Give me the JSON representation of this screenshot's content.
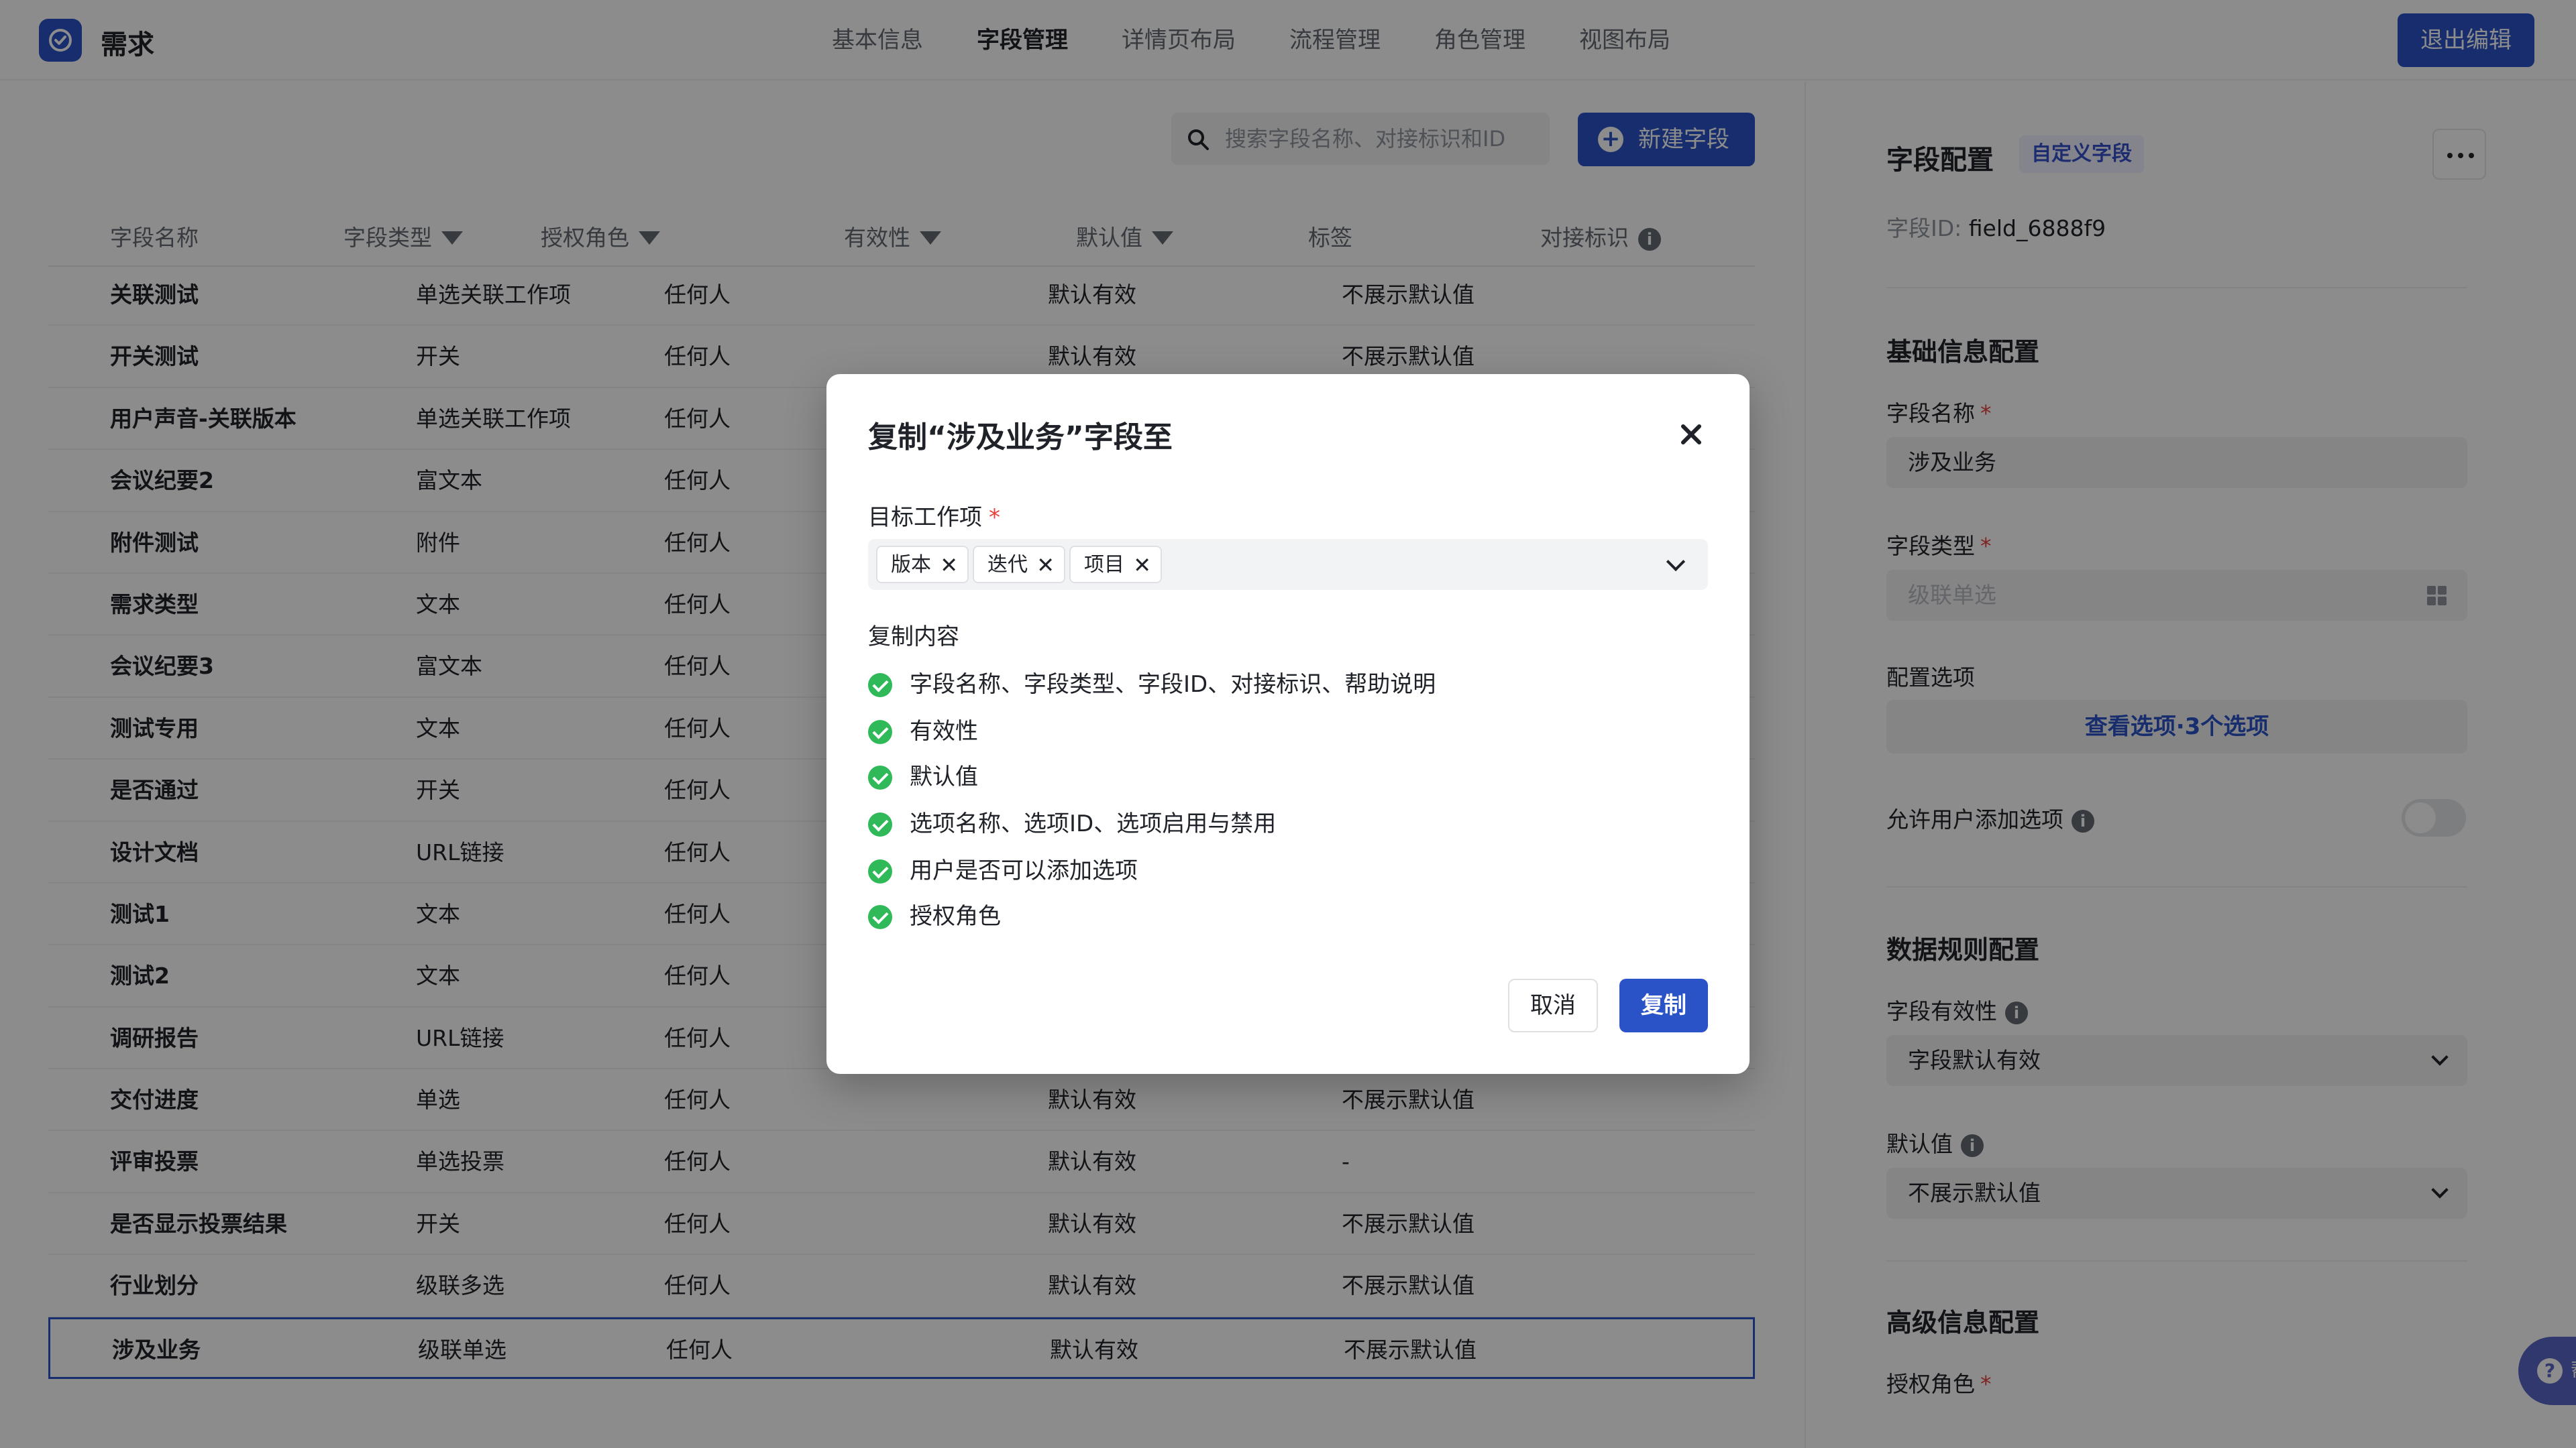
{
  "app": {
    "title": "需求"
  },
  "nav": {
    "tabs": [
      {
        "label": "基本信息",
        "active": false
      },
      {
        "label": "字段管理",
        "active": true
      },
      {
        "label": "详情页布局",
        "active": false
      },
      {
        "label": "流程管理",
        "active": false
      },
      {
        "label": "角色管理",
        "active": false
      },
      {
        "label": "视图布局",
        "active": false
      }
    ],
    "exit_label": "退出编辑"
  },
  "toolbar": {
    "search_placeholder": "搜索字段名称、对接标识和ID",
    "new_field_label": "新建字段"
  },
  "table": {
    "headers": [
      "字段名称",
      "字段类型",
      "授权角色",
      "有效性",
      "默认值",
      "标签",
      "对接标识"
    ],
    "rows": [
      {
        "name": "关联测试",
        "type": "单选关联工作项",
        "role": "任何人",
        "valid": "默认有效",
        "default": "不展示默认值"
      },
      {
        "name": "开关测试",
        "type": "开关",
        "role": "任何人",
        "valid": "默认有效",
        "default": "不展示默认值"
      },
      {
        "name": "用户声音-关联版本",
        "type": "单选关联工作项",
        "role": "任何人",
        "valid": "",
        "default": ""
      },
      {
        "name": "会议纪要2",
        "type": "富文本",
        "role": "任何人",
        "valid": "",
        "default": ""
      },
      {
        "name": "附件测试",
        "type": "附件",
        "role": "任何人",
        "valid": "",
        "default": ""
      },
      {
        "name": "需求类型",
        "type": "文本",
        "role": "任何人",
        "valid": "",
        "default": ""
      },
      {
        "name": "会议纪要3",
        "type": "富文本",
        "role": "任何人",
        "valid": "",
        "default": ""
      },
      {
        "name": "测试专用",
        "type": "文本",
        "role": "任何人",
        "valid": "",
        "default": ""
      },
      {
        "name": "是否通过",
        "type": "开关",
        "role": "任何人",
        "valid": "",
        "default": ""
      },
      {
        "name": "设计文档",
        "type": "URL链接",
        "role": "任何人",
        "valid": "",
        "default": ""
      },
      {
        "name": "测试1",
        "type": "文本",
        "role": "任何人",
        "valid": "",
        "default": ""
      },
      {
        "name": "测试2",
        "type": "文本",
        "role": "任何人",
        "valid": "",
        "default": ""
      },
      {
        "name": "调研报告",
        "type": "URL链接",
        "role": "任何人",
        "valid": "",
        "default": ""
      },
      {
        "name": "交付进度",
        "type": "单选",
        "role": "任何人",
        "valid": "默认有效",
        "default": "不展示默认值"
      },
      {
        "name": "评审投票",
        "type": "单选投票",
        "role": "任何人",
        "valid": "默认有效",
        "default": "-"
      },
      {
        "name": "是否显示投票结果",
        "type": "开关",
        "role": "任何人",
        "valid": "默认有效",
        "default": "不展示默认值"
      },
      {
        "name": "行业划分",
        "type": "级联多选",
        "role": "任何人",
        "valid": "默认有效",
        "default": "不展示默认值"
      },
      {
        "name": "涉及业务",
        "type": "级联单选",
        "role": "任何人",
        "valid": "默认有效",
        "default": "不展示默认值",
        "selected": true
      }
    ]
  },
  "panel": {
    "title": "字段配置",
    "badge": "自定义字段",
    "id_label": "字段ID:",
    "id_value": "field_6888f9",
    "basic_section": "基础信息配置",
    "name_label": "字段名称",
    "name_value": "涉及业务",
    "type_label": "字段类型",
    "type_value": "级联单选",
    "options_label": "配置选项",
    "options_link": "查看选项·3个选项",
    "allow_add_label": "允许用户添加选项",
    "data_section": "数据规则配置",
    "validity_label": "字段有效性",
    "validity_value": "字段默认有效",
    "default_label": "默认值",
    "default_value": "不展示默认值",
    "advanced_section": "高级信息配置",
    "role_label": "授权角色",
    "help_label": "帮助"
  },
  "modal": {
    "title": "复制“涉及业务”字段至",
    "target_label": "目标工作项",
    "targets": [
      "版本",
      "迭代",
      "项目"
    ],
    "content_label": "复制内容",
    "content_items": [
      "字段名称、字段类型、字段ID、对接标识、帮助说明",
      "有效性",
      "默认值",
      "选项名称、选项ID、选项启用与禁用",
      "用户是否可以添加选项",
      "授权角色"
    ],
    "cancel_label": "取消",
    "copy_label": "复制"
  }
}
